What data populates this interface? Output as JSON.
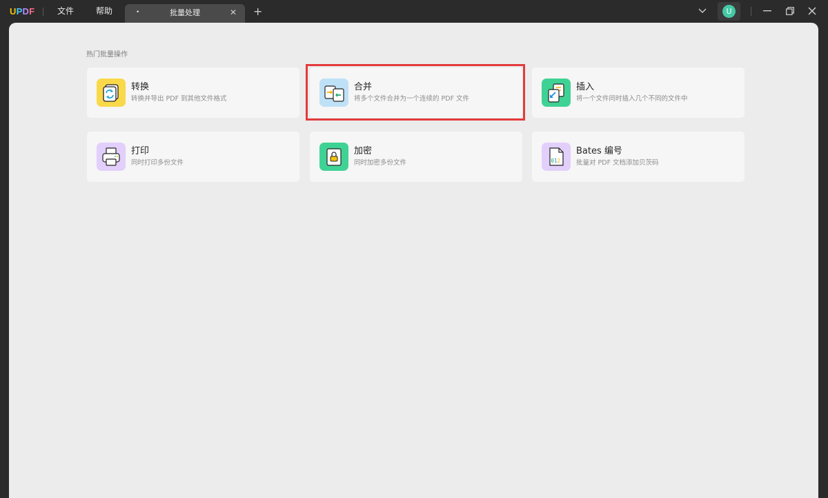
{
  "app": {
    "logo": [
      "U",
      "P",
      "D",
      "F"
    ]
  },
  "menu": {
    "file": "文件",
    "help": "帮助"
  },
  "tab": {
    "dot": "•",
    "title": "批量处理",
    "close": "✕"
  },
  "new_tab": "+",
  "user": {
    "initial": "U"
  },
  "section": {
    "title": "热门批量操作"
  },
  "cards": [
    {
      "title": "转换",
      "desc": "转换并导出 PDF 到其他文件格式",
      "icon": "convert-icon",
      "color": "#f9d84a"
    },
    {
      "title": "合并",
      "desc": "将多个文件合并为一个连续的 PDF 文件",
      "icon": "merge-icon",
      "color": "#bfe1f7"
    },
    {
      "title": "插入",
      "desc": "将一个文件同时插入几个不同的文件中",
      "icon": "insert-icon",
      "color": "#3fd295"
    },
    {
      "title": "打印",
      "desc": "同时打印多份文件",
      "icon": "print-icon",
      "color": "#e2cffb"
    },
    {
      "title": "加密",
      "desc": "同时加密多份文件",
      "icon": "encrypt-icon",
      "color": "#3fd295"
    },
    {
      "title": "Bates 编号",
      "desc": "批量对 PDF 文档添加贝茨码",
      "icon": "bates-icon",
      "color": "#e2cffb"
    }
  ],
  "colors": {
    "accent_red": "#e43a3d",
    "avatar": "#44c9a5",
    "titlebar": "#2b2b2b",
    "panel": "#ececec"
  }
}
